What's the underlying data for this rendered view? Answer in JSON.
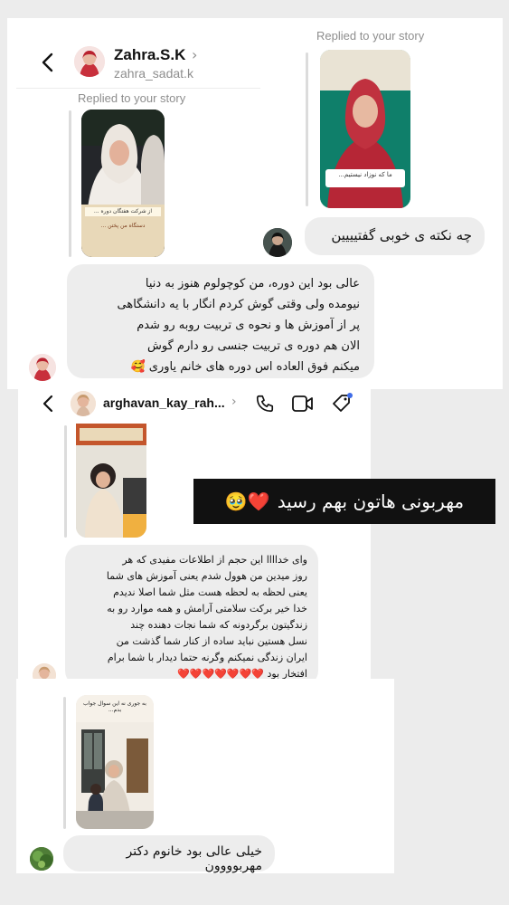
{
  "screenshot1": {
    "header": {
      "display_name": "Zahra.S.K",
      "username": "zahra_sadat.k"
    },
    "replied_label_top": "Replied to your story",
    "replied_label_left": "Replied to your story",
    "my_message": "چه نکته ی خوبی گفتیییین",
    "their_message_lines": [
      "عالی بود این دوره، من کوچولوم هنوز به دنیا",
      "نیومده ولی وقتی گوش کردم انگار با یه دانشگاهی",
      "پر از آموزش ها و نحوه ی تربیت روبه رو شدم",
      "الان هم دوره ی تربیت جنسی رو دارم گوش",
      "میکنم فوق العاده اس دوره های خانم یاوری 🥰"
    ],
    "story_caption_top": "ما که نوزاد نیستیم...",
    "story_caption_left": "از شرکت هفتگان دوره ...",
    "story_caption_left_2": "دستگاه من پختن ..."
  },
  "screenshot2": {
    "header": {
      "username": "arghavan_kay_rah..."
    },
    "message_lines": [
      "وای خداااا این حجم از اطلاعات مفیدی که هر",
      "روز میدین من هوول شدم یعنی آموزش های شما",
      "یعنی لحظه به لحظه هست مثل شما اصلا ندیدم",
      "خدا خیر برکت سلامتی آرامش و همه موارد رو به",
      "زندگیتون برگردونه که شما نجات دهنده چند",
      "نسل هستین نباید ساده از کنار شما گذشت من",
      "ایران زندگی نمیکنم وگرنه حتما دیدار با شما برام",
      "افتخار بود"
    ],
    "hearts": "❤️❤️❤️❤️❤️❤️❤️"
  },
  "banner": {
    "text": "مهربونی هاتون بهم رسید",
    "emoji": "❤️🥹"
  },
  "screenshot3": {
    "message": "خیلی عالی بود خانوم دکتر مهربوووون",
    "story_caption": "به جوری نه این سوال جواب بدم..."
  }
}
